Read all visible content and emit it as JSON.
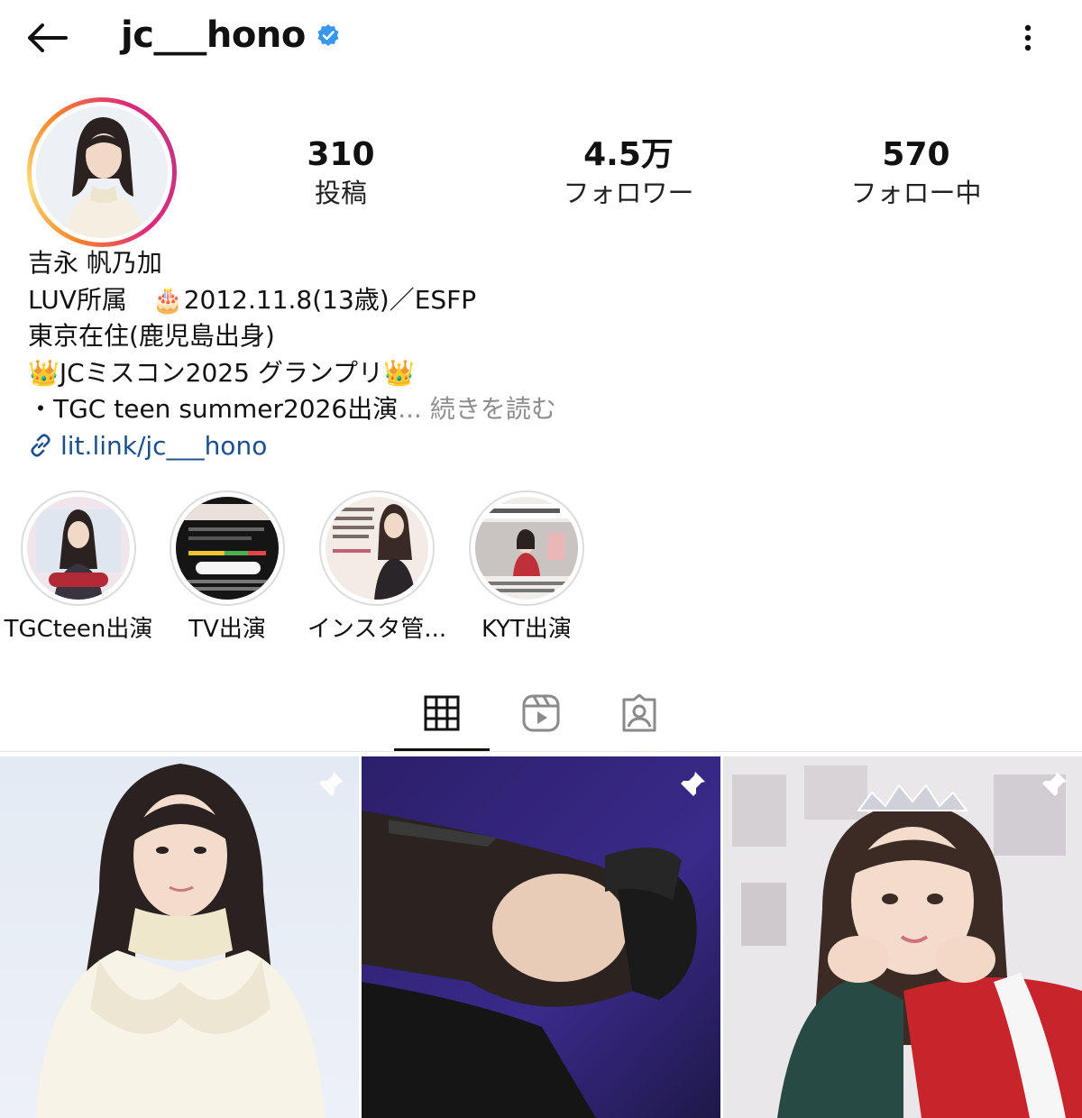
{
  "header": {
    "username": "jc___hono",
    "verified": true,
    "back_icon": "arrow-left-icon",
    "more_icon": "more-vertical-icon"
  },
  "stats": [
    {
      "value": "310",
      "label": "投稿"
    },
    {
      "value": "4.5万",
      "label": "フォロワー"
    },
    {
      "value": "570",
      "label": "フォロー中"
    }
  ],
  "bio": {
    "name": "吉永 帆乃加",
    "line1_prefix": "LUV所属　",
    "line1_icon": "🎂",
    "line1_text": "2012.11.8(13歳)／ESFP",
    "line2": "東京在住(鹿児島出身)",
    "line3_icon": "👑",
    "line3_text": "JCミスコン2025 グランプリ",
    "line4": "・TGC teen summer2026出演",
    "more_label": "... 続きを読む",
    "link": "lit.link/jc___hono"
  },
  "highlights": [
    {
      "label": "TGCteen出演"
    },
    {
      "label": "TV出演"
    },
    {
      "label": "インスタ管..."
    },
    {
      "label": "KYT出演"
    }
  ],
  "tabs": [
    {
      "name": "posts",
      "icon": "grid-icon",
      "active": true
    },
    {
      "name": "reels",
      "icon": "reels-icon",
      "active": false
    },
    {
      "name": "tagged",
      "icon": "tagged-icon",
      "active": false
    }
  ],
  "posts": [
    {
      "pinned": true
    },
    {
      "pinned": true
    },
    {
      "pinned": true
    }
  ],
  "colors": {
    "link": "#1a4f8a",
    "verified": "#3897f0",
    "muted": "#8e8e8e"
  }
}
